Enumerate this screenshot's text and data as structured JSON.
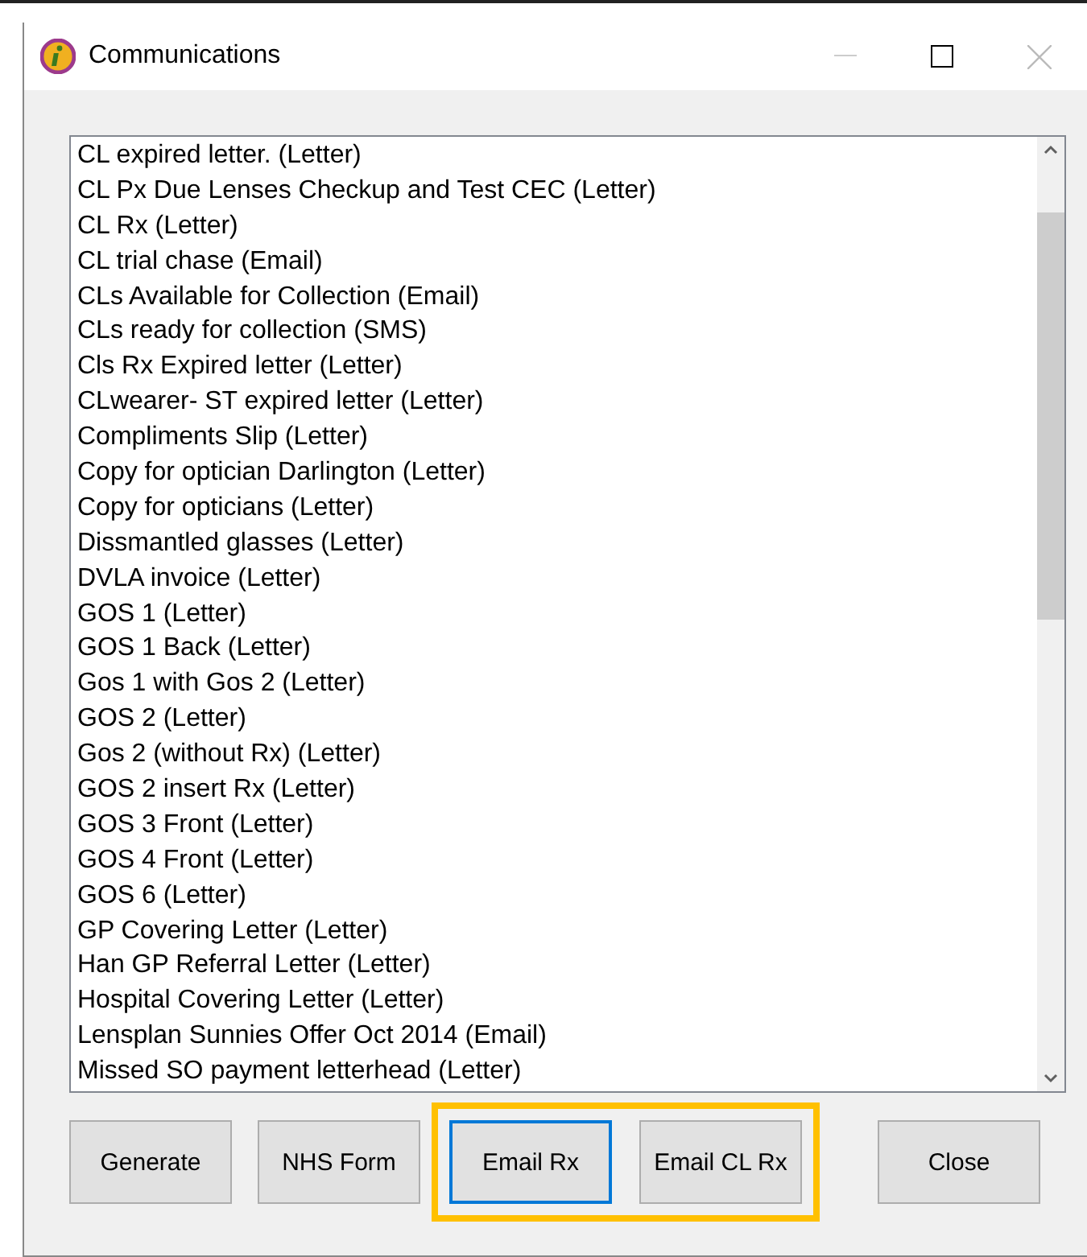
{
  "window": {
    "title": "Communications"
  },
  "list": {
    "items": [
      {
        "label": "CL expired letter. (Letter)"
      },
      {
        "label": "CL Px Due Lenses Checkup and Test CEC (Letter)"
      },
      {
        "label": "CL Rx (Letter)"
      },
      {
        "label": "CL trial chase (Email)"
      },
      {
        "label": "CLs Available for Collection (Email)"
      },
      {
        "label": "CLs ready for collection (SMS)"
      },
      {
        "label": "Cls Rx Expired letter (Letter)"
      },
      {
        "label": "CLwearer- ST expired letter (Letter)"
      },
      {
        "label": "Compliments Slip (Letter)"
      },
      {
        "label": "Copy for optician Darlington (Letter)"
      },
      {
        "label": "Copy for opticians (Letter)"
      },
      {
        "label": "Dissmantled glasses (Letter)"
      },
      {
        "label": "DVLA invoice (Letter)"
      },
      {
        "label": "GOS 1 (Letter)"
      },
      {
        "label": "GOS 1 Back  (Letter)"
      },
      {
        "label": "Gos 1 with Gos 2 (Letter)"
      },
      {
        "label": "GOS 2 (Letter)"
      },
      {
        "label": "Gos 2 (without Rx) (Letter)"
      },
      {
        "label": "GOS 2 insert Rx (Letter)"
      },
      {
        "label": "GOS 3 Front (Letter)"
      },
      {
        "label": "GOS 4 Front (Letter)"
      },
      {
        "label": "GOS 6 (Letter)"
      },
      {
        "label": "GP Covering Letter (Letter)"
      },
      {
        "label": "Han GP Referral Letter (Letter)"
      },
      {
        "label": "Hospital Covering Letter (Letter)"
      },
      {
        "label": "Lensplan Sunnies Offer Oct 2014 (Email)"
      },
      {
        "label": "Missed SO payment letterhead (Letter)"
      }
    ]
  },
  "buttons": [
    {
      "label": "Generate",
      "selected": false,
      "highlighted": false
    },
    {
      "label": "NHS Form",
      "selected": false,
      "highlighted": false
    },
    {
      "label": "Email Rx",
      "selected": true,
      "highlighted": true
    },
    {
      "label": "Email CL Rx",
      "selected": false,
      "highlighted": true
    },
    {
      "label": "Close",
      "selected": false,
      "highlighted": false
    }
  ]
}
